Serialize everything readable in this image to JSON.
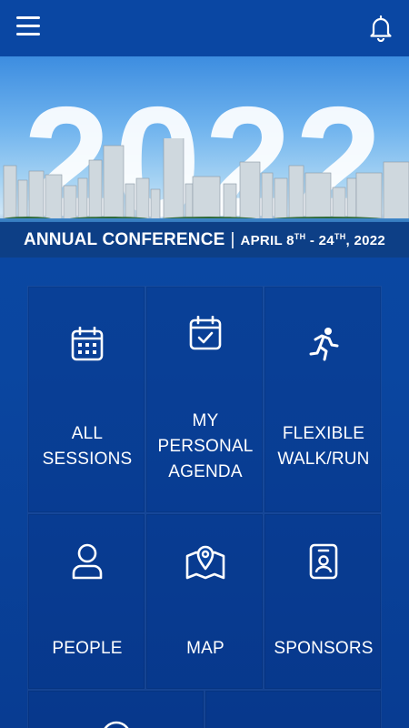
{
  "header": {
    "menu_icon": "hamburger-menu-icon",
    "notification_icon": "bell-icon"
  },
  "banner": {
    "year": "2022",
    "title": "ANNUAL CONFERENCE",
    "separator": "|",
    "dates_prefix": "APRIL 8",
    "dates_sup1": "TH",
    "dates_mid": " - 24",
    "dates_sup2": "TH",
    "dates_suffix": ", 2022"
  },
  "tiles": [
    {
      "label": "ALL\nSESSIONS",
      "icon": "calendar-grid-icon"
    },
    {
      "label": "MY\nPERSONAL\nAGENDA",
      "icon": "calendar-check-icon"
    },
    {
      "label": "FLEXIBLE\nWALK/RUN",
      "icon": "running-person-icon"
    },
    {
      "label": "PEOPLE",
      "icon": "person-icon"
    },
    {
      "label": "MAP",
      "icon": "map-pin-icon"
    },
    {
      "label": "SPONSORS",
      "icon": "id-badge-icon"
    },
    {
      "label": "",
      "icon": "circle-icon"
    },
    {
      "label": "",
      "icon": ""
    }
  ],
  "colors": {
    "background": "#0a46a0",
    "caption_bar": "#0d3f86",
    "text": "#ffffff"
  }
}
